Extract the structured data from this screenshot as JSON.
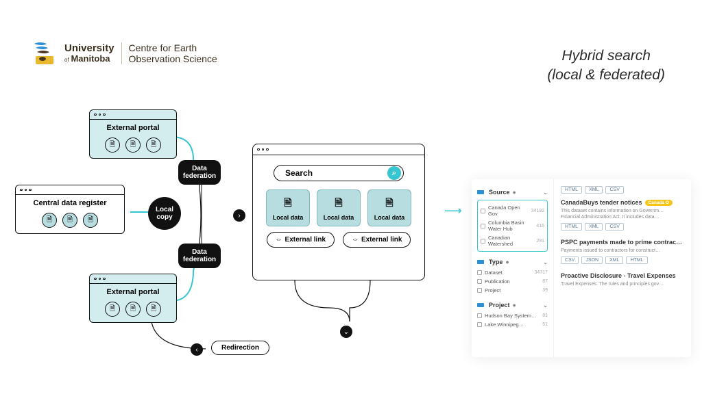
{
  "logo": {
    "uni_line1": "University",
    "uni_line2": "Manitoba",
    "uni_prefix": "of",
    "centre_line1": "Centre for Earth",
    "centre_line2": "Observation Science"
  },
  "title_line1": "Hybrid search",
  "title_line2": "(local & federated)",
  "diagram": {
    "external_portal": "External portal",
    "central_register": "Central data register",
    "data_federation": "Data federation",
    "local_copy": "Local copy",
    "search": "Search",
    "local_data": "Local data",
    "external_link": "External link",
    "redirection": "Redirection"
  },
  "screenshot": {
    "facets": {
      "source": {
        "label": "Source",
        "items": [
          {
            "name": "Canada Open Gov",
            "count": "34192"
          },
          {
            "name": "Columbia Basin Water Hub",
            "count": "415"
          },
          {
            "name": "Canadian Watershed",
            "count": "291"
          }
        ]
      },
      "type": {
        "label": "Type",
        "items": [
          {
            "name": "Dataset",
            "count": "34717"
          },
          {
            "name": "Publication",
            "count": "87"
          },
          {
            "name": "Project",
            "count": "39"
          }
        ]
      },
      "project": {
        "label": "Project",
        "items": [
          {
            "name": "Hudson Bay System…",
            "count": "81"
          },
          {
            "name": "Lake Winnipeg…",
            "count": "51"
          }
        ]
      }
    },
    "tags_top": [
      "HTML",
      "XML",
      "CSV"
    ],
    "results": [
      {
        "title": "CanadaBuys tender notices",
        "badge": "Canada O",
        "desc": "This dataset contains information on Governm… Financial Administration Act. It includes data…",
        "tags": [
          "HTML",
          "XML",
          "CSV"
        ]
      },
      {
        "title": "PSPC payments made to prime contrac…",
        "desc": "Payments issued to contractors for construct…",
        "tags": [
          "CSV",
          "JSON",
          "XML",
          "HTML"
        ]
      },
      {
        "title": "Proactive Disclosure - Travel Expenses",
        "desc": "Travel Expenses: The rules and principles gov…"
      }
    ]
  }
}
